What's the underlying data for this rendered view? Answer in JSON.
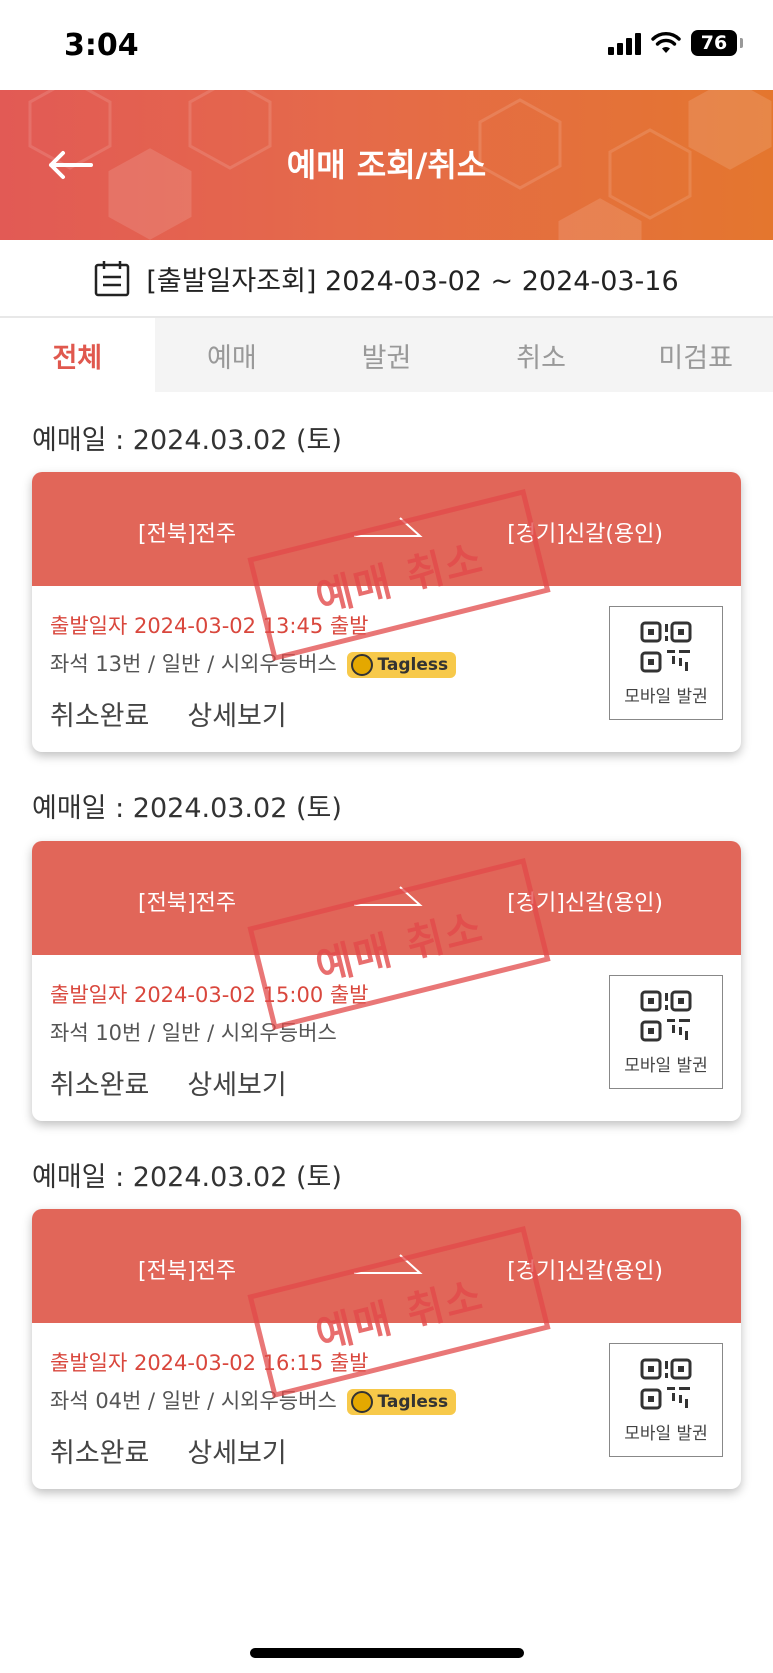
{
  "status": {
    "time": "3:04",
    "battery": "76"
  },
  "header": {
    "title": "예매 조회/취소"
  },
  "date_range": {
    "text": "[출발일자조회] 2024-03-02 ~ 2024-03-16"
  },
  "tabs": [
    {
      "label": "전체",
      "active": true
    },
    {
      "label": "예매"
    },
    {
      "label": "발권"
    },
    {
      "label": "취소"
    },
    {
      "label": "미검표"
    }
  ],
  "reservations": [
    {
      "date_label": "예매일 : 2024.03.02 (토)",
      "from": "[전북]전주",
      "to": "[경기]신갈(용인)",
      "depart": "출발일자 2024-03-02 13:45 출발",
      "seat": "좌석 13번 / 일반 / 시외우등버스",
      "tagless": "Tagless",
      "status": "취소완료",
      "detail": "상세보기",
      "qr_label": "모바일 발권",
      "stamp": "예매 취소"
    },
    {
      "date_label": "예매일 : 2024.03.02 (토)",
      "from": "[전북]전주",
      "to": "[경기]신갈(용인)",
      "depart": "출발일자 2024-03-02 15:00 출발",
      "seat": "좌석 10번 / 일반 / 시외우등버스",
      "status": "취소완료",
      "detail": "상세보기",
      "qr_label": "모바일 발권",
      "stamp": "예매 취소"
    },
    {
      "date_label": "예매일 : 2024.03.02 (토)",
      "from": "[전북]전주",
      "to": "[경기]신갈(용인)",
      "depart": "출발일자 2024-03-02 16:15 출발",
      "seat": "좌석 04번 / 일반 / 시외우등버스",
      "tagless": "Tagless",
      "status": "취소완료",
      "detail": "상세보기",
      "qr_label": "모바일 발권",
      "stamp": "예매 취소"
    }
  ],
  "colors": {
    "accent": "#e0584e",
    "card_header": "#e16659",
    "header_start": "#e25a55",
    "header_end": "#e4762e"
  },
  "icons": {
    "back": "arrow-left-icon",
    "calendar": "calendar-icon",
    "qr": "qr-code-icon"
  }
}
